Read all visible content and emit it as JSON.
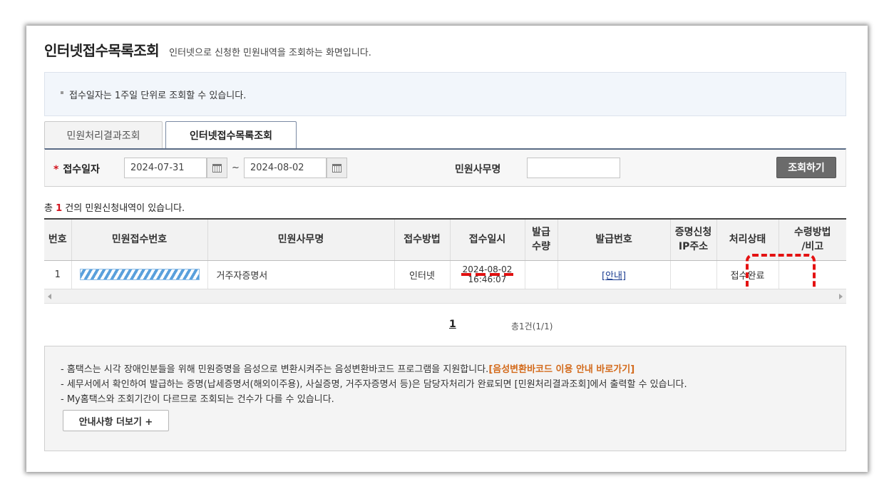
{
  "header": {
    "title": "인터넷접수목록조회",
    "description": "인터넷으로 신청한 민원내역을 조회하는 화면입니다."
  },
  "notice": {
    "text": "접수일자는 1주일 단위로 조회할 수 있습니다."
  },
  "tabs": [
    {
      "label": "민원처리결과조회",
      "active": false
    },
    {
      "label": "인터넷접수목록조회",
      "active": true
    }
  ],
  "search": {
    "required_mark": "*",
    "date_label": "접수일자",
    "date_from": "2024-07-31",
    "date_to": "2024-08-02",
    "tilde": "~",
    "service_label": "민원사무명",
    "service_value": "",
    "button_label": "조회하기"
  },
  "result_count": {
    "prefix": "총",
    "count": "1",
    "suffix": "건의 민원신청내역이 있습니다."
  },
  "table": {
    "headers": [
      "번호",
      "민원접수번호",
      "민원사무명",
      "접수방법",
      "접수일시",
      "발급수량",
      "발급번호",
      "증명신청IP주소",
      "처리상태",
      "수령방법/비고"
    ],
    "header_lines": [
      [
        "번호"
      ],
      [
        "민원접수번호"
      ],
      [
        "민원사무명"
      ],
      [
        "접수방법"
      ],
      [
        "접수일시"
      ],
      [
        "발급",
        "수량"
      ],
      [
        "발급번호"
      ],
      [
        "증명신청",
        "IP주소"
      ],
      [
        "처리상태"
      ],
      [
        "수령방법",
        "/비고"
      ]
    ],
    "rows": [
      {
        "no": "1",
        "receipt_no": "",
        "service": "거주자증명서",
        "method": "인터넷",
        "date": "2024-08-02",
        "time": "16:46:07",
        "quantity": "",
        "issue_no": "[안내]",
        "ip": "",
        "status": "접수완료",
        "remark": ""
      }
    ]
  },
  "pagination": {
    "current": "1",
    "total": "총1건(1/1)"
  },
  "info": {
    "lines": [
      {
        "text": "- 홈택스는 시각 장애인분들을 위해 민원증명을 음성으로 변환시켜주는 음성변환바코드 프로그램을 지원합니다.",
        "link": "[음성변환바코드 이용 안내 바로가기]"
      },
      {
        "text": "- 세무서에서 확인하여 발급하는 증명(납세증명서(해외이주용), 사실증명, 거주자증명서 등)은 담당자처리가 완료되면 [민원처리결과조회]에서 출력할 수 있습니다.",
        "link": ""
      },
      {
        "text": "- My홈택스와 조회기간이 다르므로 조회되는 건수가 다를 수 있습니다.",
        "link": ""
      }
    ],
    "more_button": "안내사항 더보기 +"
  },
  "colors": {
    "accent_red": "#d2141e",
    "highlight_border": "#e41212",
    "link_orange": "#d36a1b",
    "link_blue": "#1d3e91"
  }
}
